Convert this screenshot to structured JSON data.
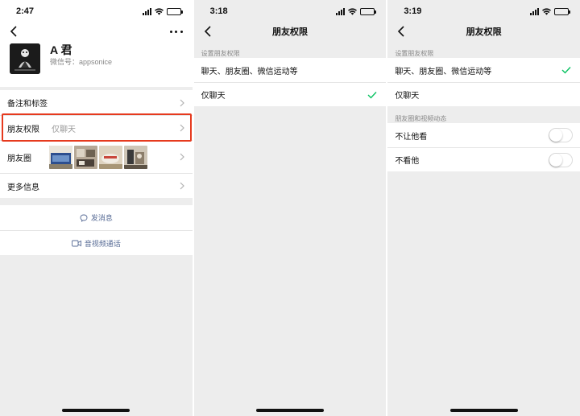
{
  "screen1": {
    "time": "2:47",
    "profile": {
      "name": "A 君",
      "wechat_id": "微信号：appsonice"
    },
    "rows": {
      "remarks": {
        "label": "备注和标签"
      },
      "permissions": {
        "label": "朋友权限",
        "value": "仅聊天"
      },
      "moments": {
        "label": "朋友圈"
      },
      "more_info": {
        "label": "更多信息"
      }
    },
    "actions": {
      "message": "发消息",
      "video_call": "音视频通话"
    },
    "highlight_color": "#e63a1e"
  },
  "screen2": {
    "time": "3:18",
    "title": "朋友权限",
    "section": "设置朋友权限",
    "options": [
      "聊天、朋友圈、微信运动等",
      "仅聊天"
    ],
    "selected_index": 1
  },
  "screen3": {
    "time": "3:19",
    "title": "朋友权限",
    "section": "设置朋友权限",
    "options": [
      "聊天、朋友圈、微信运动等",
      "仅聊天"
    ],
    "selected_index": 0,
    "moments_section": "朋友圈和视频动态",
    "toggles": [
      {
        "label": "不让他看",
        "on": false
      },
      {
        "label": "不看他",
        "on": false
      }
    ]
  },
  "colors": {
    "check": "#07c160",
    "link": "#576b95",
    "background": "#ededed"
  }
}
